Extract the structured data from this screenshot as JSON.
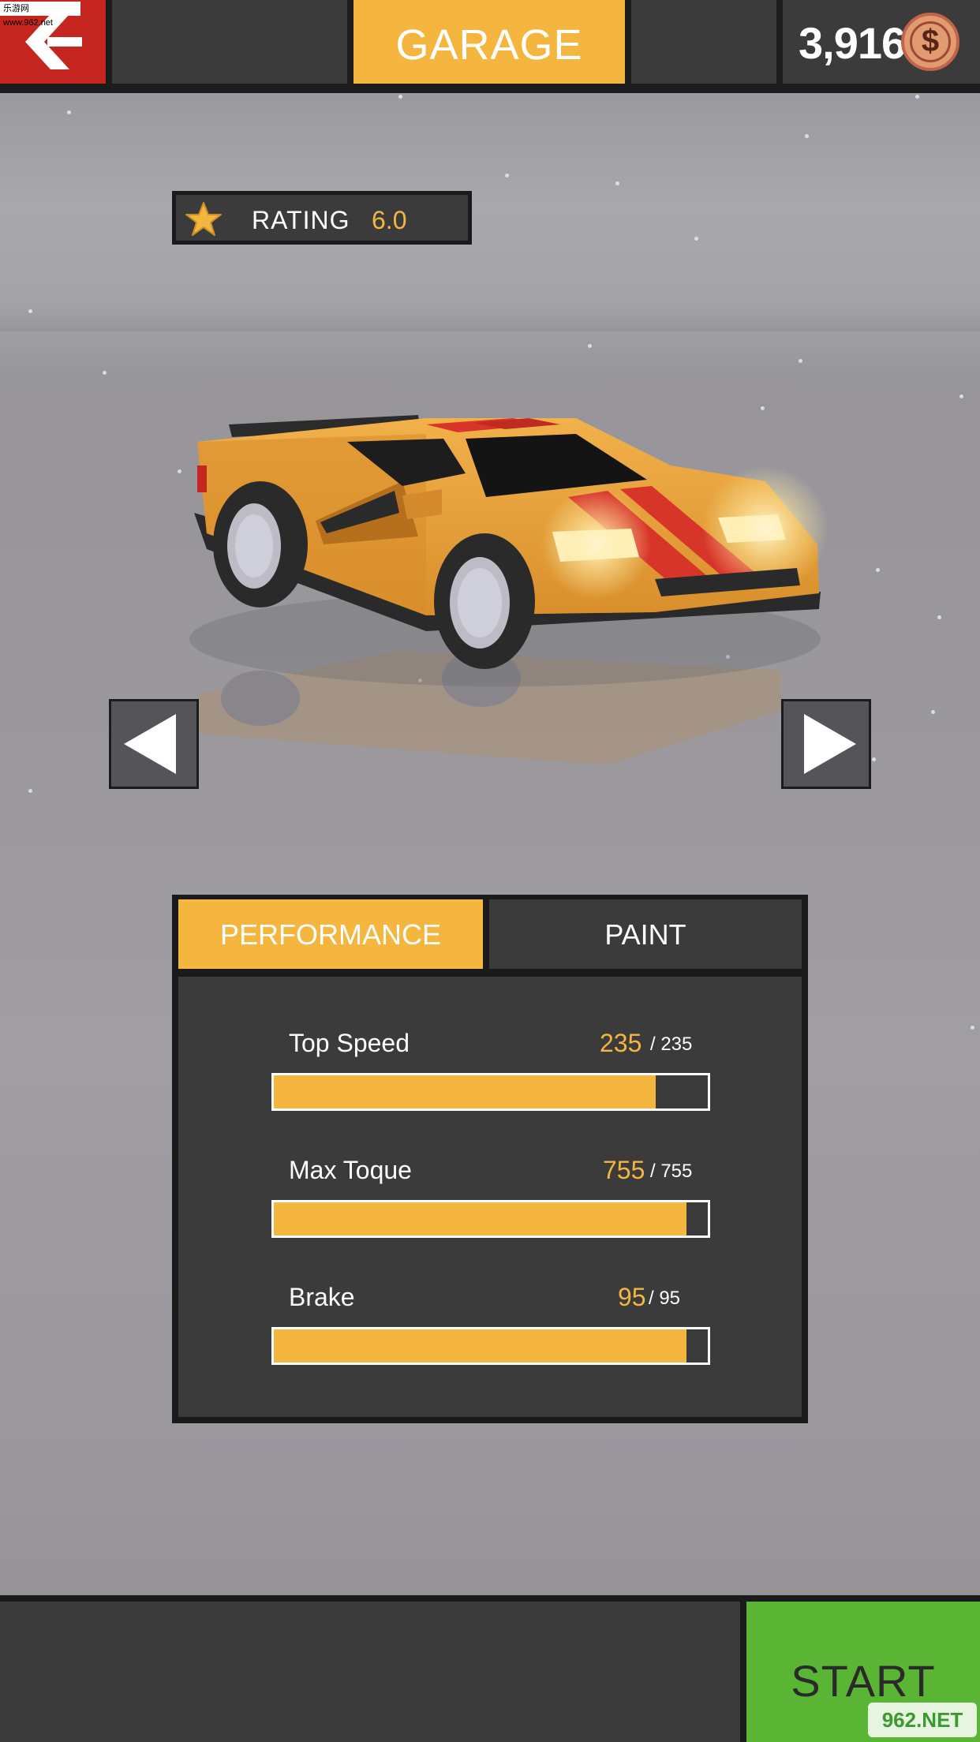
{
  "header": {
    "back_icon": "chevron-left-icon",
    "title": "GARAGE",
    "coins": "3,916",
    "coin_symbol": "$"
  },
  "rating": {
    "label": "RATING",
    "value": "6.0"
  },
  "tabs": {
    "performance": "PERFORMANCE",
    "paint": "PAINT"
  },
  "stats": [
    {
      "name": "Top Speed",
      "value": "235",
      "max": "/ 235",
      "fill_fraction": 0.88
    },
    {
      "name": "Max Toque",
      "value": "755",
      "max": "/ 755",
      "fill_fraction": 0.95
    },
    {
      "name": "Brake",
      "value": "95",
      "max": "/ 95",
      "fill_fraction": 0.95
    }
  ],
  "footer": {
    "start_label": "START"
  },
  "watermarks": {
    "top": "乐游网 www.962.net",
    "bottom": "962.NET"
  },
  "colors": {
    "accent_yellow": "#f4b63f",
    "back_red": "#c5261f",
    "start_green": "#5bb534",
    "panel_dark": "#3b3b3b"
  }
}
